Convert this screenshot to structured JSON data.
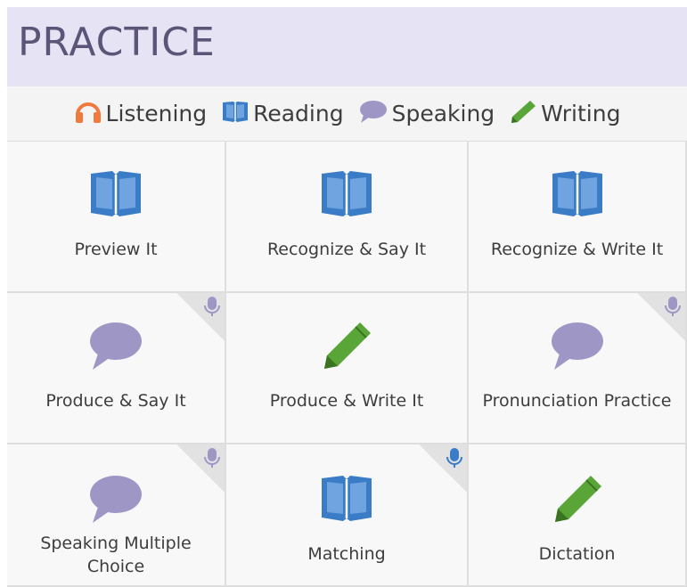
{
  "header": {
    "title": "PRACTICE"
  },
  "legend": [
    {
      "icon": "headphones-icon",
      "label": "Listening",
      "color": "#f07a3c"
    },
    {
      "icon": "book-icon",
      "label": "Reading",
      "color": "#3a7cc6"
    },
    {
      "icon": "speech-bubble-icon",
      "label": "Speaking",
      "color": "#9e97c6"
    },
    {
      "icon": "pencil-icon",
      "label": "Writing",
      "color": "#5aa537"
    }
  ],
  "activities": [
    {
      "label": "Preview It",
      "icon": "book-icon",
      "mic": false
    },
    {
      "label": "Recognize & Say It",
      "icon": "book-icon",
      "mic": false
    },
    {
      "label": "Recognize & Write It",
      "icon": "book-icon",
      "mic": false
    },
    {
      "label": "Produce & Say It",
      "icon": "speech-bubble-icon",
      "mic": true
    },
    {
      "label": "Produce & Write It",
      "icon": "pencil-icon",
      "mic": false
    },
    {
      "label": "Pronunciation Practice",
      "icon": "speech-bubble-icon",
      "mic": true
    },
    {
      "label": "Speaking Multiple Choice",
      "icon": "speech-bubble-icon",
      "mic": true
    },
    {
      "label": "Matching",
      "icon": "book-icon",
      "mic": true
    },
    {
      "label": "Dictation",
      "icon": "pencil-icon",
      "mic": false
    }
  ],
  "colors": {
    "reading": "#3a7cc6",
    "speaking": "#9e97c6",
    "writing": "#5aa537",
    "listening": "#f07a3c",
    "mic_speaking": "#9e97c6",
    "mic_reading": "#3a7cc6"
  }
}
